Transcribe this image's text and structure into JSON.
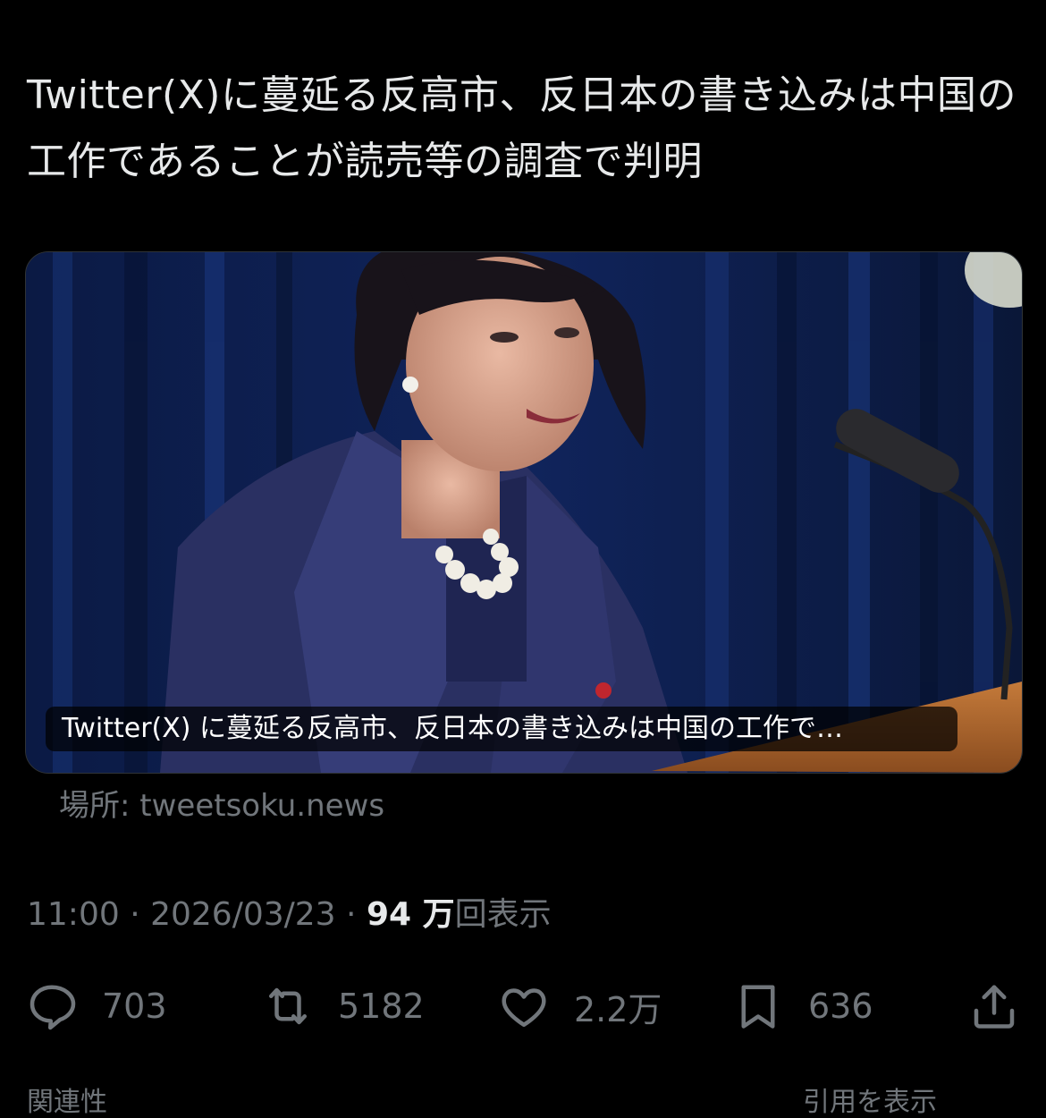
{
  "tweet": {
    "text": "Twitter(X)に蔓延る反高市、反日本の書き込みは中国の工作であることが読売等の調査で判明"
  },
  "card": {
    "caption": "Twitter(X) に蔓延る反高市、反日本の書き込みは中国の工作で…",
    "source": "場所: tweetsoku.news"
  },
  "meta": {
    "time": "11:00",
    "sep1": " · ",
    "date": "2026/03/23",
    "sep2": " · ",
    "views_count": "94 万",
    "views_label": "回表示"
  },
  "actions": {
    "reply": {
      "icon": "reply-icon",
      "count": "703"
    },
    "retweet": {
      "icon": "retweet-icon",
      "count": "5182"
    },
    "like": {
      "icon": "heart-icon",
      "count": "2.2万"
    },
    "bookmark": {
      "icon": "bookmark-icon",
      "count": "636"
    },
    "share": {
      "icon": "share-icon"
    }
  },
  "bottom": {
    "left_label": "関連性",
    "right_label": "引用を表示"
  },
  "colors": {
    "background": "#000000",
    "text": "#e7e9ea",
    "muted": "#71767b"
  }
}
